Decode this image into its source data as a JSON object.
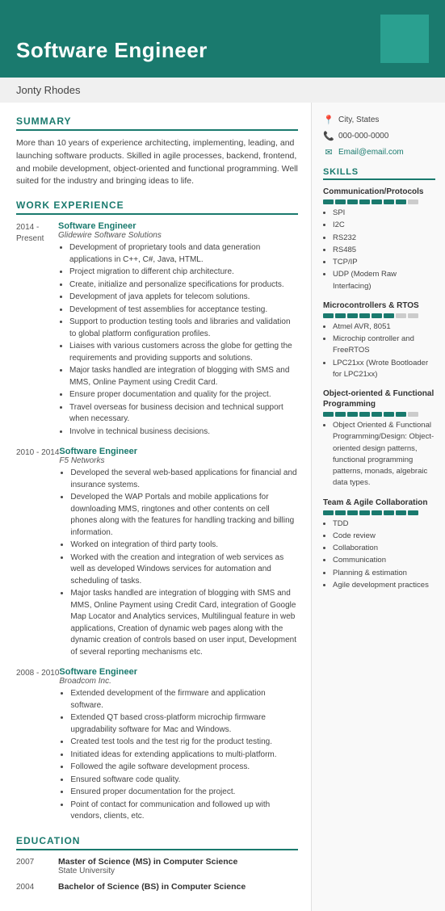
{
  "header": {
    "title": "Software Engineer",
    "name": "Jonty Rhodes"
  },
  "contact": {
    "location": "City, States",
    "phone": "000-000-0000",
    "email": "Email@email.com"
  },
  "summary": {
    "title": "SUMMARY",
    "text": "More than 10 years of experience architecting, implementing, leading, and launching software products. Skilled in agile processes, backend, frontend, and mobile development, object-oriented and functional programming. Well suited for the industry and bringing ideas to life."
  },
  "work_experience": {
    "title": "WORK EXPERIENCE",
    "jobs": [
      {
        "dates": "2014 -\nPresent",
        "title": "Software Engineer",
        "company": "Glidewire Software Solutions",
        "bullets": [
          "Development of proprietary tools and data generation applications in C++, C#, Java, HTML.",
          "Project migration to different chip architecture.",
          "Create, initialize and personalize specifications for products.",
          "Development of java applets for telecom solutions.",
          "Development of test assemblies for acceptance testing.",
          "Support to production testing tools and libraries and validation to global platform configuration profiles.",
          "Liaises with various customers across the globe for getting the requirements and providing supports and solutions.",
          "Major tasks handled are integration of blogging with SMS and MMS, Online Payment using Credit Card.",
          "Ensure proper documentation and quality for the project.",
          "Travel overseas for business decision and technical support when necessary.",
          "Involve in technical business decisions."
        ]
      },
      {
        "dates": "2010 - 2014",
        "title": "Software Engineer",
        "company": "F5 Networks",
        "bullets": [
          "Developed the several web-based applications for financial and insurance systems.",
          "Developed the WAP Portals and mobile applications for downloading MMS, ringtones and other contents on cell phones along with the features for handling tracking and billing information.",
          "Worked on integration of third party tools.",
          "Worked with the creation and integration of web services as well as developed Windows services for automation and scheduling of tasks.",
          "Major tasks handled are integration of blogging with SMS and MMS, Online Payment using Credit Card, integration of Google Map Locator and Analytics services, Multilingual feature in web applications, Creation of dynamic web pages along with the dynamic creation of controls based on user input, Development of several reporting mechanisms etc."
        ]
      },
      {
        "dates": "2008 - 2010",
        "title": "Software Engineer",
        "company": "Broadcom Inc.",
        "bullets": [
          "Extended development of the firmware and application software.",
          "Extended QT based cross-platform microchip firmware upgradability software for Mac and Windows.",
          "Created test tools and the test rig for the product testing.",
          "Initiated ideas for extending applications to multi-platform.",
          "Followed the agile software development process.",
          "Ensured software code quality.",
          "Ensured proper documentation for the project.",
          "Point of contact for communication and followed up with vendors, clients, etc."
        ]
      }
    ]
  },
  "education": {
    "title": "EDUCATION",
    "items": [
      {
        "year": "2007",
        "degree": "Master of Science (MS) in Computer Science",
        "school": "State University"
      },
      {
        "year": "2004",
        "degree": "Bachelor of Science (BS) in Computer Science",
        "school": ""
      }
    ]
  },
  "skills": {
    "title": "SKILLS",
    "categories": [
      {
        "name": "Communication/Protocols",
        "bars": 8,
        "filled": 7,
        "items": [
          "SPI",
          "I2C",
          "RS232",
          "RS485",
          "TCP/IP",
          "UDP (Modem Raw Interfacing)"
        ]
      },
      {
        "name": "Microcontrollers & RTOS",
        "bars": 8,
        "filled": 6,
        "items": [
          "Atmel AVR, 8051",
          "Microchip controller and FreeRTOS",
          "LPC21xx (Wrote Bootloader for LPC21xx)"
        ]
      },
      {
        "name": "Object-oriented & Functional Programming",
        "bars": 8,
        "filled": 7,
        "items": [
          "Object Oriented & Functional Programming/Design: Object-oriented design patterns, functional programming patterns, monads, algebraic data types."
        ]
      },
      {
        "name": "Team & Agile Collaboration",
        "bars": 8,
        "filled": 8,
        "items": [
          "TDD",
          "Code review",
          "Collaboration",
          "Communication",
          "Planning & estimation",
          "Agile development practices"
        ]
      }
    ]
  }
}
